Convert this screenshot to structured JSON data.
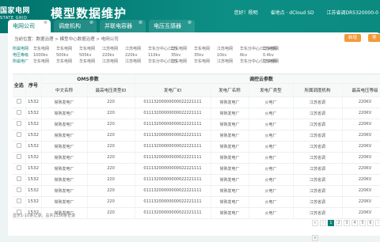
{
  "header": {
    "logo_cn": "国家电网",
    "logo_en": "STATE GRID",
    "app_title": "模型数据维护",
    "greeting": "您好！杨明",
    "province": "省地点 · dCloud SD",
    "station": "江苏省调DR5320000-0"
  },
  "tabs": [
    {
      "label": "电网公司",
      "close": "⊗"
    },
    {
      "label": "调度机构",
      "close": "⊗"
    },
    {
      "label": "并联电容器",
      "close": "⊗"
    },
    {
      "label": "电压互感器",
      "close": "⊗"
    }
  ],
  "breadcrumb": "当前位置：数据治理 > 模型中心数据治理 > 电网公司",
  "buttons": {
    "a": "新增",
    "b": "导出"
  },
  "filter_rows": [
    [
      "所属电网",
      "华东电网",
      "华东电网",
      "华东电网",
      "江苏电网",
      "江苏电网",
      "华东分中心/江苏",
      "华东电网",
      "华东电网",
      "江苏电网",
      "华东分中心/江苏电网",
      "华东电网"
    ],
    [
      "电压等级",
      "1000kv",
      "500kv",
      "500kv",
      "220kv",
      "220kv",
      "110kv",
      "35kv",
      "35kv",
      "10kv",
      "6kv",
      "0.4kv"
    ],
    [
      "所属电厂",
      "华东电网",
      "华东电网",
      "华东电网",
      "江苏电网",
      "江苏电网",
      "华东分中心/江苏",
      "华东电网",
      "华东电网",
      "江苏电网",
      "华东分中心/江苏电网",
      "华东电网"
    ]
  ],
  "table": {
    "group_left": "OMS参数",
    "group_right": "调控云参数",
    "select_label": "全选",
    "columns": [
      "序号",
      "中文名称",
      "最高电压类型ID",
      "发电厂ID",
      "发电厂名称",
      "发电厂类型",
      "所属调度机构",
      "最高电压等级"
    ],
    "rows": [
      [
        "1532",
        "常熟发电厂",
        "220",
        "01113200000000022221111",
        "常熟发电厂",
        "火电厂",
        "江苏省调",
        "220KV"
      ],
      [
        "1532",
        "常熟发电厂",
        "220",
        "01113200000000022221111",
        "常熟发电厂",
        "火电厂",
        "江苏省调",
        "220KV"
      ],
      [
        "1532",
        "常熟发电厂",
        "220",
        "01113200000000022221111",
        "常熟发电厂",
        "火电厂",
        "江苏省调",
        "220KV"
      ],
      [
        "1532",
        "常熟发电厂",
        "220",
        "01113200000000022221111",
        "常熟发电厂",
        "火电厂",
        "江苏省调",
        "220KV"
      ],
      [
        "1532",
        "常熟发电厂",
        "220",
        "01113200000000022221111",
        "常熟发电厂",
        "火电厂",
        "江苏省调",
        "220KV"
      ],
      [
        "1532",
        "常熟发电厂",
        "220",
        "01113200000000022221111",
        "常熟发电厂",
        "火电厂",
        "江苏省调",
        "220KV"
      ],
      [
        "1532",
        "常熟发电厂",
        "220",
        "01113200000000022221111",
        "常熟发电厂",
        "火电厂",
        "江苏省调",
        "220KV"
      ],
      [
        "1532",
        "常熟发电厂",
        "220",
        "01113200000000022221111",
        "常熟发电厂",
        "火电厂",
        "江苏省调",
        "220KV"
      ],
      [
        "1532",
        "常熟发电厂",
        "220",
        "01113200000000022221111",
        "常熟发电厂",
        "火电厂",
        "江苏省调",
        "220KV"
      ],
      [
        "1532",
        "常熟发电厂",
        "220",
        "01113200000000022221111",
        "常熟发电厂",
        "火电厂",
        "江苏省调",
        "220KV"
      ],
      [
        "1532",
        "常熟发电厂",
        "220",
        "01113200000000022221111",
        "常熟发电厂",
        "火电厂",
        "江苏省调",
        "220KV"
      ]
    ]
  },
  "pagination": {
    "info": "显示1-10条记录，总共1156条记录",
    "pages": [
      "«",
      "‹",
      "1",
      "2",
      "3",
      "4",
      "5",
      "6",
      "›",
      "»"
    ],
    "active": "1"
  }
}
